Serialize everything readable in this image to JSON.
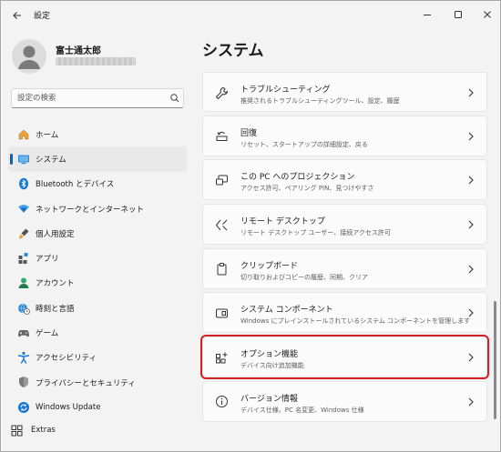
{
  "window": {
    "title": "設定"
  },
  "profile": {
    "name": "富士通太郎"
  },
  "search": {
    "placeholder": "設定の検索"
  },
  "sidebar": {
    "items": [
      {
        "label": "ホーム",
        "icon": "home-icon"
      },
      {
        "label": "システム",
        "icon": "system-icon",
        "active": true
      },
      {
        "label": "Bluetooth とデバイス",
        "icon": "bluetooth-icon"
      },
      {
        "label": "ネットワークとインターネット",
        "icon": "network-icon"
      },
      {
        "label": "個人用設定",
        "icon": "brush-icon"
      },
      {
        "label": "アプリ",
        "icon": "apps-icon"
      },
      {
        "label": "アカウント",
        "icon": "account-icon"
      },
      {
        "label": "時刻と言語",
        "icon": "globe-clock-icon"
      },
      {
        "label": "ゲーム",
        "icon": "gamepad-icon"
      },
      {
        "label": "アクセシビリティ",
        "icon": "accessibility-icon"
      },
      {
        "label": "プライバシーとセキュリティ",
        "icon": "shield-icon"
      },
      {
        "label": "Windows Update",
        "icon": "update-icon"
      }
    ],
    "extras_label": "Extras"
  },
  "main": {
    "title": "システム",
    "cards": [
      {
        "title": "トラブルシューティング",
        "desc": "推奨されるトラブルシューティングツール、設定、履歴",
        "icon": "wrench-icon"
      },
      {
        "title": "回復",
        "desc": "リセット、スタートアップの詳細設定、戻る",
        "icon": "recovery-icon"
      },
      {
        "title": "この PC へのプロジェクション",
        "desc": "アクセス許可、ペアリング PIN、見つけやすさ",
        "icon": "projection-icon"
      },
      {
        "title": "リモート デスクトップ",
        "desc": "リモート デスクトップ ユーザー、接続アクセス許可",
        "icon": "remote-desktop-icon"
      },
      {
        "title": "クリップボード",
        "desc": "切り取りおよびコピーの履歴、同期、クリア",
        "icon": "clipboard-icon"
      },
      {
        "title": "システム コンポーネント",
        "desc": "Windows にプレインストールされているシステム コンポーネントを管理します",
        "icon": "component-icon"
      },
      {
        "title": "オプション機能",
        "desc": "デバイス向け追加機能",
        "icon": "optional-features-icon",
        "highlighted": true
      },
      {
        "title": "バージョン情報",
        "desc": "デバイス仕様、PC 名変更、Windows 仕様",
        "icon": "info-icon"
      }
    ]
  },
  "colors": {
    "accent": "#0067c0",
    "highlight": "#d32027",
    "background": "#f3f3f3",
    "card": "#fbfbfb"
  }
}
